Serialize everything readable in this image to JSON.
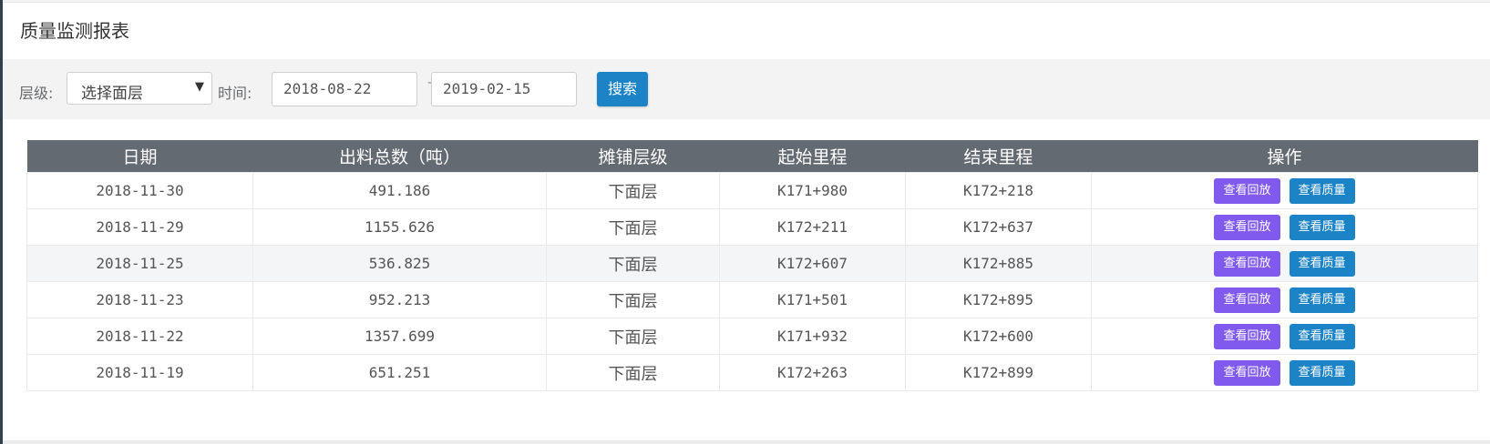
{
  "page": {
    "title": "质量监测报表"
  },
  "filters": {
    "layer_label": "层级:",
    "layer_selected": "选择面层",
    "time_label": "时间:",
    "start_date": "2018-08-22",
    "date_separator": "-",
    "end_date": "2019-02-15",
    "search_label": "搜索"
  },
  "table": {
    "headers": [
      "日期",
      "出料总数（吨）",
      "摊铺层级",
      "起始里程",
      "结束里程",
      "操作"
    ],
    "rows": [
      {
        "date": "2018-11-30",
        "total": "491.186",
        "layer": "下面层",
        "start": "K171+980",
        "end": "K172+218",
        "replay": "查看回放",
        "quality": "查看质量"
      },
      {
        "date": "2018-11-29",
        "total": "1155.626",
        "layer": "下面层",
        "start": "K172+211",
        "end": "K172+637",
        "replay": "查看回放",
        "quality": "查看质量"
      },
      {
        "date": "2018-11-25",
        "total": "536.825",
        "layer": "下面层",
        "start": "K172+607",
        "end": "K172+885",
        "replay": "查看回放",
        "quality": "查看质量"
      },
      {
        "date": "2018-11-23",
        "total": "952.213",
        "layer": "下面层",
        "start": "K171+501",
        "end": "K172+895",
        "replay": "查看回放",
        "quality": "查看质量"
      },
      {
        "date": "2018-11-22",
        "total": "1357.699",
        "layer": "下面层",
        "start": "K171+932",
        "end": "K172+600",
        "replay": "查看回放",
        "quality": "查看质量"
      },
      {
        "date": "2018-11-19",
        "total": "651.251",
        "layer": "下面层",
        "start": "K172+263",
        "end": "K172+899",
        "replay": "查看回放",
        "quality": "查看质量"
      }
    ]
  },
  "colors": {
    "header_bg": "#636a72",
    "replay_button": "#8059ee",
    "quality_button": "#1c84c6",
    "search_button": "#1c84c6"
  },
  "icons": {
    "select_arrow": "caret-down-icon"
  }
}
